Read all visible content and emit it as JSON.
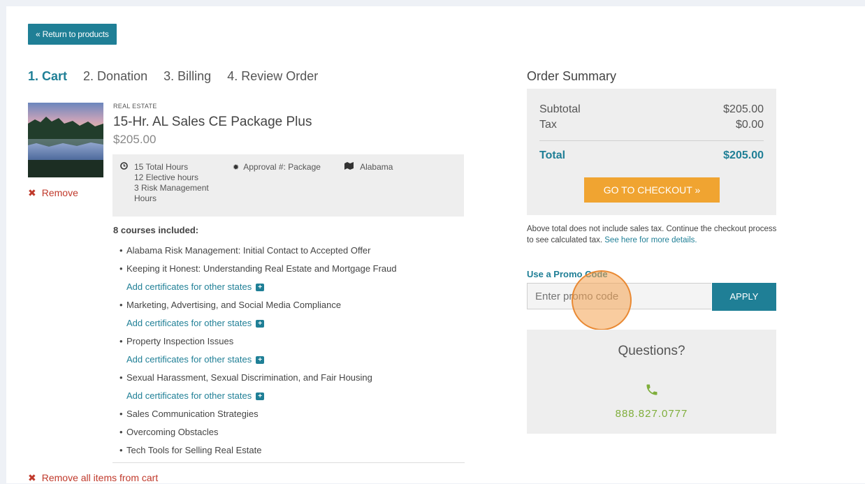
{
  "nav": {
    "return_label": "« Return to products"
  },
  "steps": [
    {
      "label": "1. Cart",
      "active": true
    },
    {
      "label": "2. Donation",
      "active": false
    },
    {
      "label": "3. Billing",
      "active": false
    },
    {
      "label": "4. Review Order",
      "active": false
    }
  ],
  "cart_item": {
    "category": "REAL ESTATE",
    "title": "15-Hr. AL Sales CE Package Plus",
    "price": "$205.00",
    "remove_label": "Remove",
    "hours": [
      "15 Total Hours",
      "12 Elective hours",
      "3 Risk Management Hours"
    ],
    "approval": "Approval #: Package",
    "state": "Alabama",
    "courses_heading": "8 courses included:",
    "add_cert_label": "Add certificates for other states",
    "courses": [
      "Alabama Risk Management: Initial Contact to Accepted Offer",
      "Keeping it Honest: Understanding Real Estate and Mortgage Fraud",
      "Marketing, Advertising, and Social Media Compliance",
      "Property Inspection Issues",
      "Sexual Harassment, Sexual Discrimination, and Fair Housing",
      "Sales Communication Strategies",
      "Overcoming Obstacles",
      "Tech Tools for Selling Real Estate"
    ]
  },
  "remove_all_label": "Remove all items from cart",
  "summary": {
    "title": "Order Summary",
    "subtotal_label": "Subtotal",
    "subtotal_value": "$205.00",
    "tax_label": "Tax",
    "tax_value": "$0.00",
    "total_label": "Total",
    "total_value": "$205.00",
    "checkout_label": "GO TO CHECKOUT »",
    "tax_note": "Above total does not include sales tax. Continue the checkout process to see calculated tax.",
    "tax_note_link": "See here for more details."
  },
  "promo": {
    "label": "Use a Promo Code",
    "placeholder": "Enter promo code",
    "apply_label": "APPLY"
  },
  "questions": {
    "title": "Questions?",
    "phone": "888.827.0777"
  },
  "colors": {
    "accent": "#1f7f96",
    "checkout": "#f0a431",
    "remove": "#c0392b",
    "phone": "#7fae3b"
  }
}
